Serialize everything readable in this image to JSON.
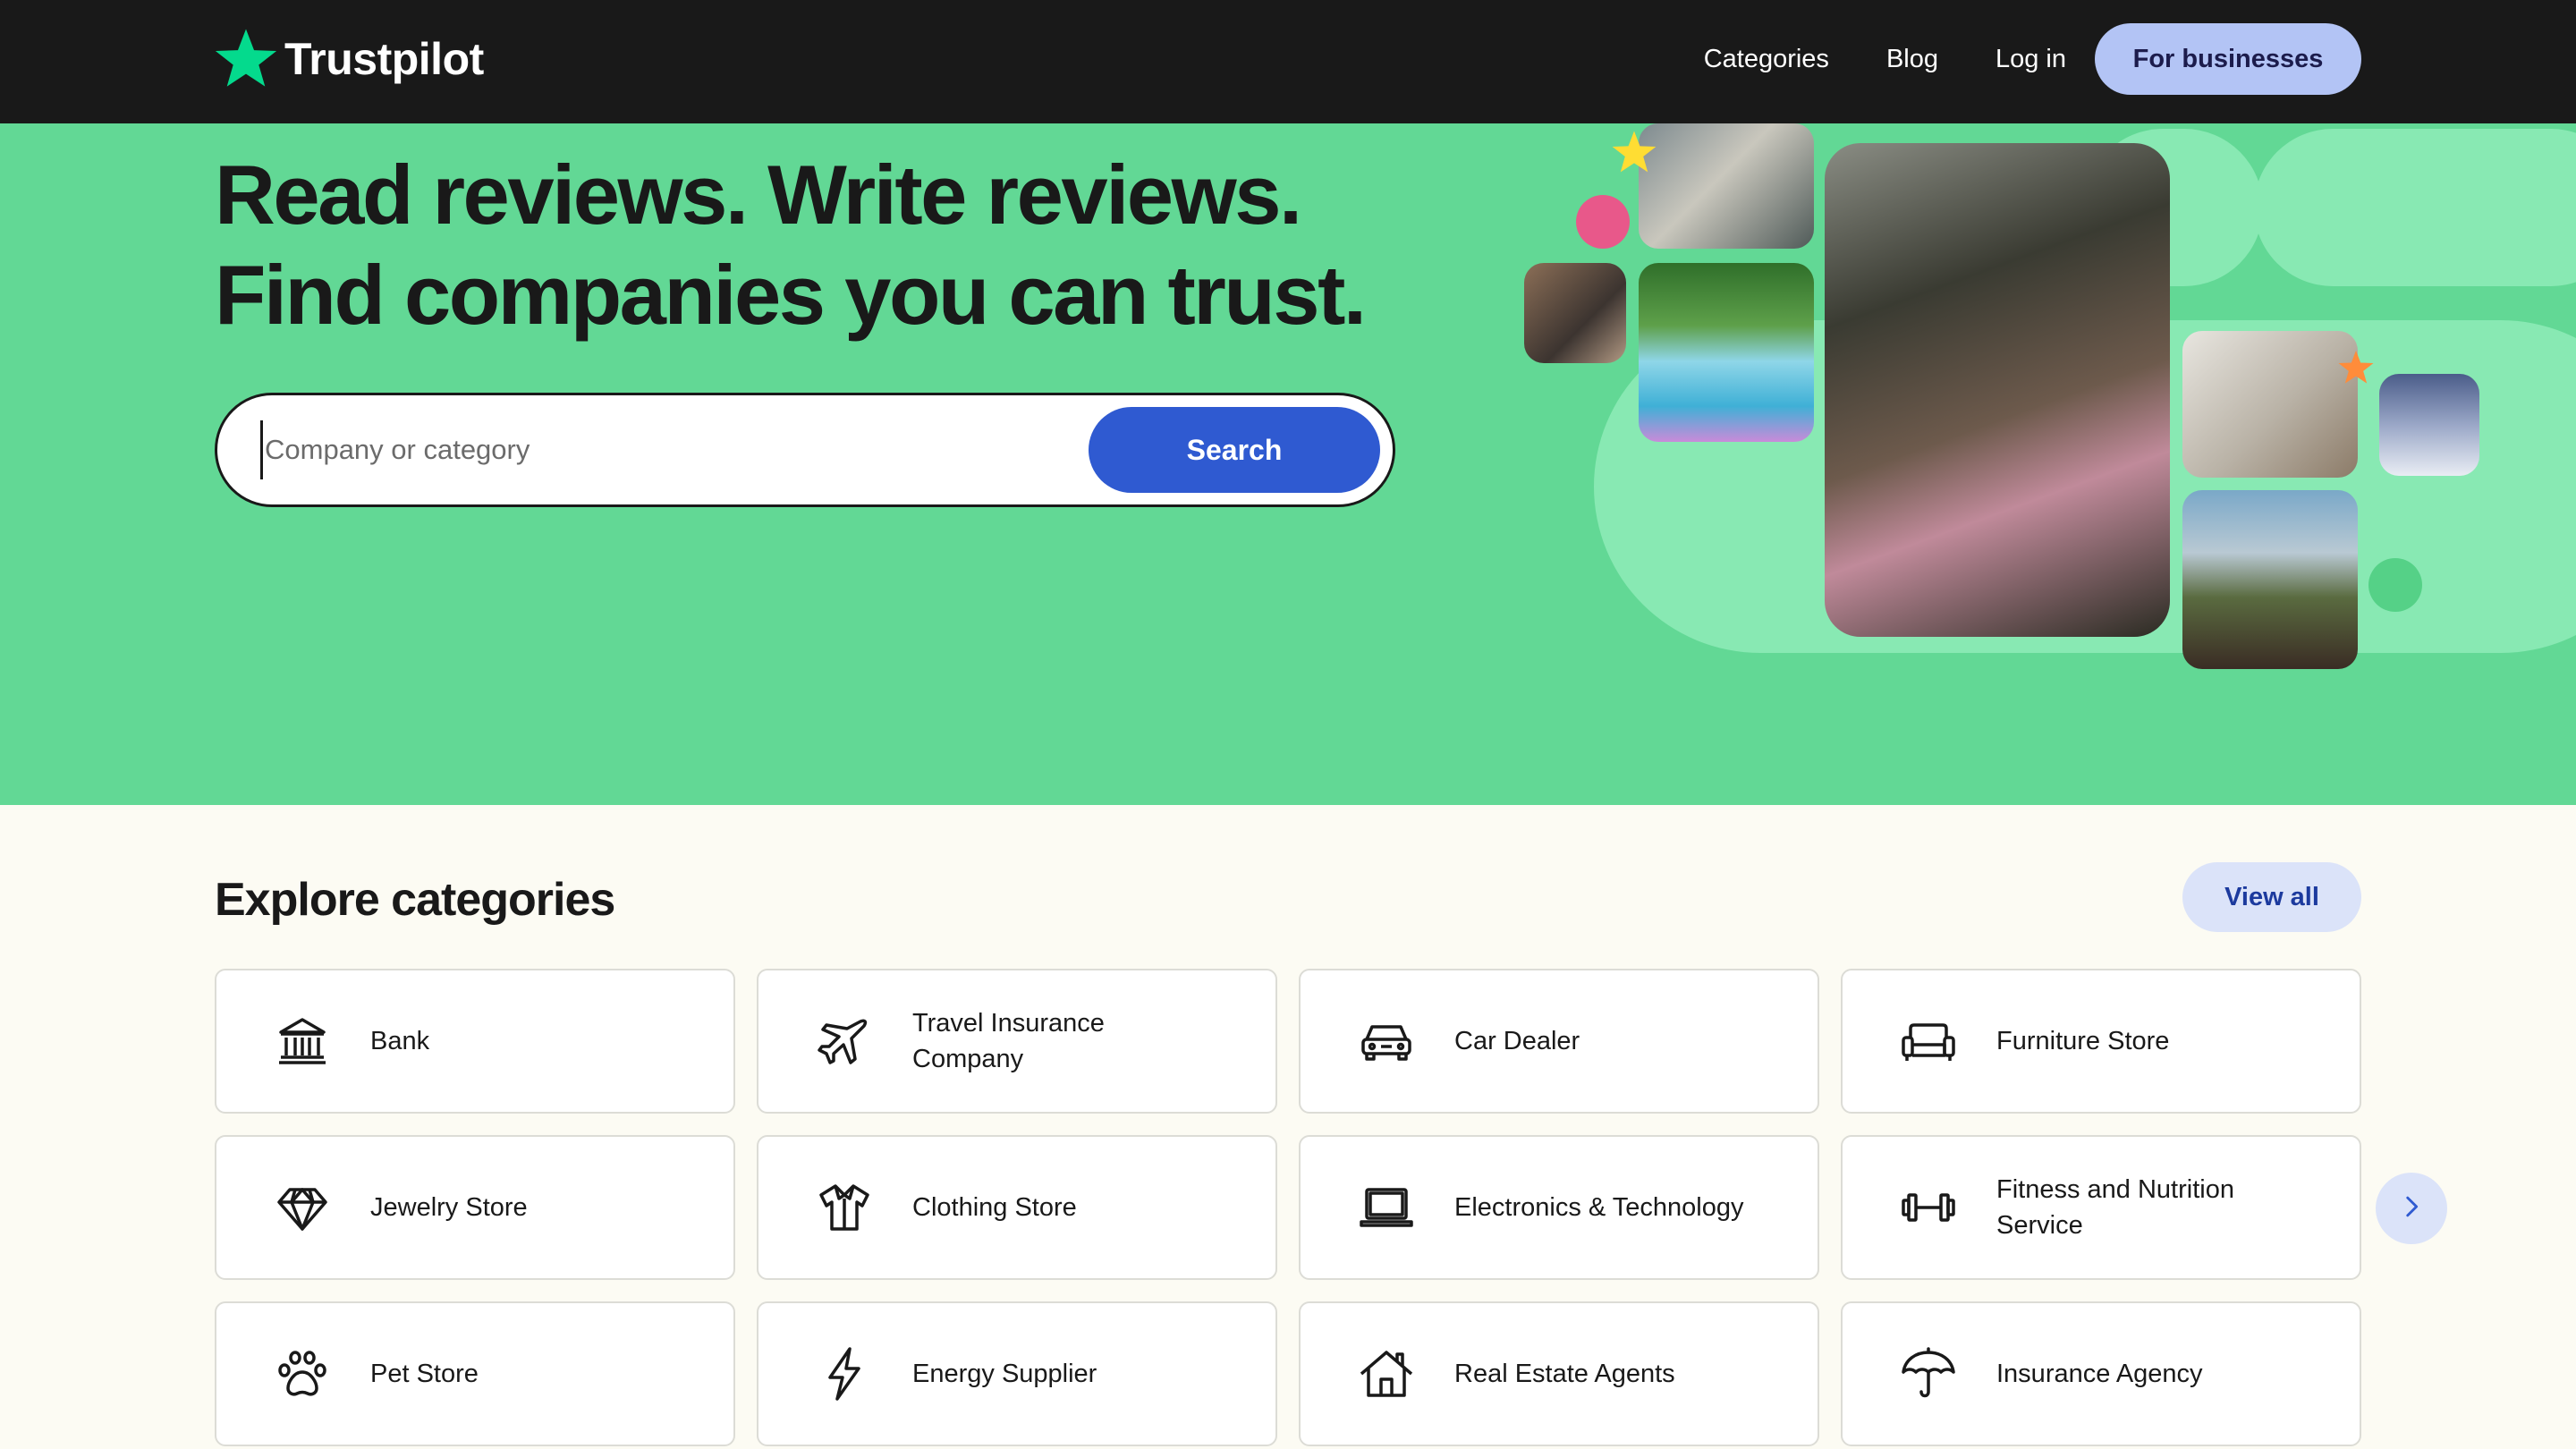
{
  "header": {
    "logo_text": "Trustpilot",
    "nav": {
      "categories": "Categories",
      "blog": "Blog",
      "login": "Log in",
      "for_businesses": "For businesses"
    }
  },
  "hero": {
    "headline_line1": "Read reviews. Write reviews.",
    "headline_line2": "Find companies you can trust.",
    "search": {
      "placeholder": "Company or category",
      "button": "Search"
    }
  },
  "categories": {
    "title": "Explore categories",
    "view_all": "View all",
    "items": [
      {
        "label": "Bank",
        "icon": "bank-icon"
      },
      {
        "label": "Travel Insurance Company",
        "icon": "airplane-icon"
      },
      {
        "label": "Car Dealer",
        "icon": "car-icon"
      },
      {
        "label": "Furniture Store",
        "icon": "sofa-icon"
      },
      {
        "label": "Jewelry Store",
        "icon": "diamond-icon"
      },
      {
        "label": "Clothing Store",
        "icon": "shirt-icon"
      },
      {
        "label": "Electronics & Technology",
        "icon": "laptop-icon"
      },
      {
        "label": "Fitness and Nutrition Service",
        "icon": "dumbbell-icon"
      },
      {
        "label": "Pet Store",
        "icon": "paw-icon"
      },
      {
        "label": "Energy Supplier",
        "icon": "lightning-icon"
      },
      {
        "label": "Real Estate Agents",
        "icon": "house-icon"
      },
      {
        "label": "Insurance Agency",
        "icon": "umbrella-icon"
      }
    ]
  },
  "colors": {
    "header_bg": "#191919",
    "hero_bg": "#62d895",
    "brand_star": "#04da8d",
    "search_button": "#2f5ad1",
    "business_button": "#b3c4f5",
    "page_bg": "#fcfbf3"
  }
}
